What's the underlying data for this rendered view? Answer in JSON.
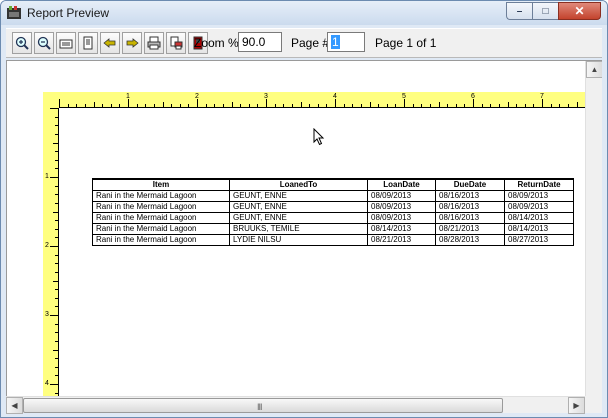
{
  "window": {
    "title": "Report Preview",
    "minimize_label": "–",
    "maximize_label": "□",
    "close_label": "✕"
  },
  "toolbar": {
    "buttons": [
      {
        "name": "zoom-in-icon"
      },
      {
        "name": "zoom-out-icon"
      },
      {
        "name": "page-width-icon"
      },
      {
        "name": "whole-page-icon"
      },
      {
        "name": "previous-page-icon"
      },
      {
        "name": "next-page-icon"
      },
      {
        "name": "print-icon"
      },
      {
        "name": "print-setup-icon"
      },
      {
        "name": "exit-icon"
      }
    ],
    "zoom_label": "Zoom %",
    "zoom_value": "90.0",
    "page_label": "Page #",
    "page_value": "1",
    "page_count": "Page 1 of 1"
  },
  "ruler": {
    "horizontal_numbers": [
      "1",
      "2",
      "3",
      "4",
      "5",
      "6",
      "7"
    ],
    "vertical_numbers": [
      "1",
      "2",
      "3",
      "4"
    ]
  },
  "report": {
    "columns": [
      "Item",
      "LoanedTo",
      "LoanDate",
      "DueDate",
      "ReturnDate"
    ],
    "rows": [
      [
        "Rani in the Mermaid Lagoon",
        "GEUNT, ENNE",
        "08/09/2013",
        "08/16/2013",
        "08/09/2013"
      ],
      [
        "Rani in the Mermaid Lagoon",
        "GEUNT, ENNE",
        "08/09/2013",
        "08/16/2013",
        "08/09/2013"
      ],
      [
        "Rani in the Mermaid Lagoon",
        "GEUNT, ENNE",
        "08/09/2013",
        "08/16/2013",
        "08/14/2013"
      ],
      [
        "Rani in the Mermaid Lagoon",
        "BRUUKS, TEMILE",
        "08/14/2013",
        "08/21/2013",
        "08/14/2013"
      ],
      [
        "Rani in the Mermaid Lagoon",
        "LYDIE NILSU",
        "08/21/2013",
        "08/28/2013",
        "08/27/2013"
      ]
    ]
  },
  "scrollbar": {
    "grip": "III"
  },
  "colors": {
    "ruler": "#ffff80",
    "selection": "#3399ff",
    "close_button": "#c3432d"
  }
}
